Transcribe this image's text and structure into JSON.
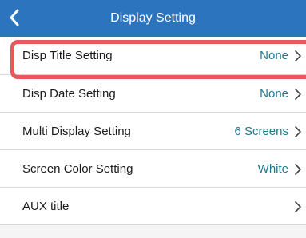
{
  "header": {
    "title": "Display Setting",
    "back_icon": "chevron-left-icon"
  },
  "settings": [
    {
      "label": "Disp Title Setting",
      "value": "None"
    },
    {
      "label": "Disp Date Setting",
      "value": "None"
    },
    {
      "label": "Multi Display Setting",
      "value": "6 Screens"
    },
    {
      "label": "Screen Color Setting",
      "value": "White"
    },
    {
      "label": "AUX title",
      "value": ""
    }
  ],
  "colors": {
    "header_bg": "#2c74bd",
    "value_text": "#1b7a8f",
    "highlight_border": "#e8585a"
  },
  "row_icon": "chevron-right-icon"
}
